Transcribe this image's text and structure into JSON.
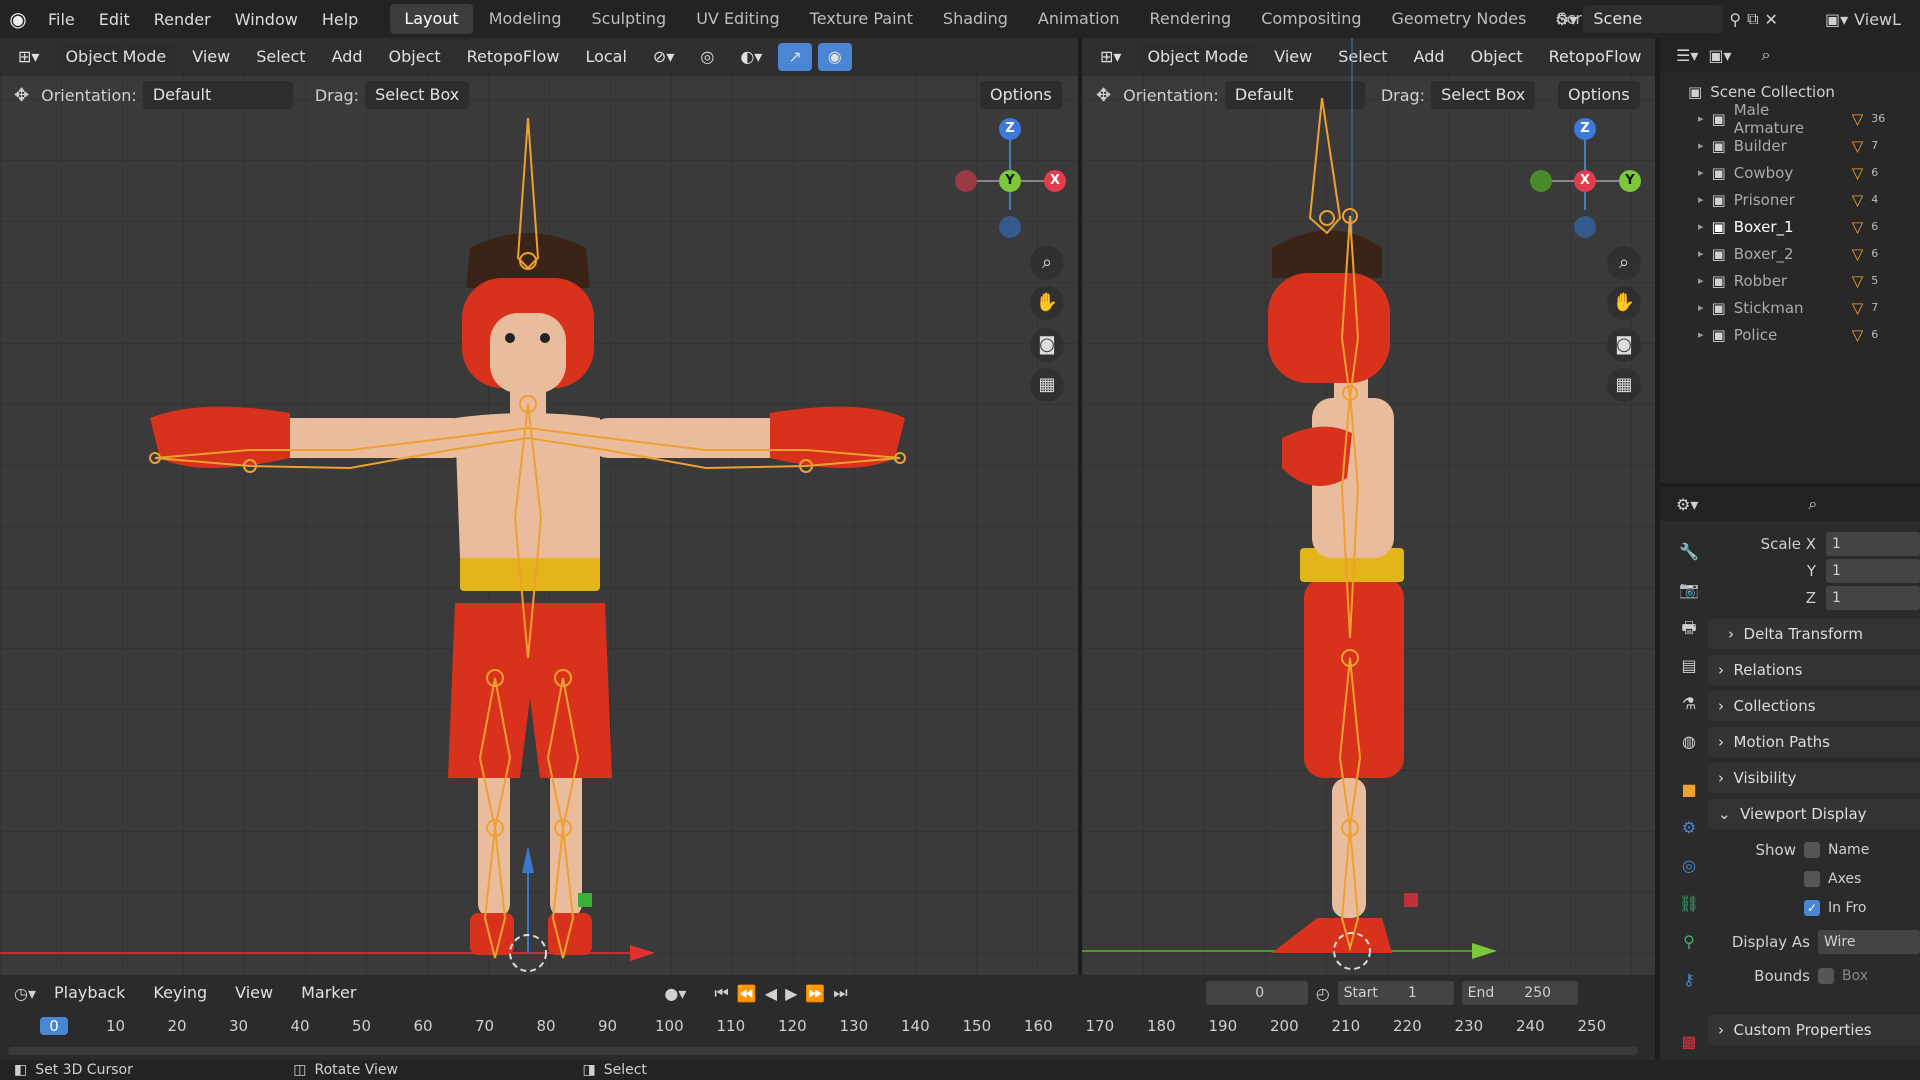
{
  "topbar": {
    "menus": [
      "File",
      "Edit",
      "Render",
      "Window",
      "Help"
    ],
    "workspaces": [
      "Layout",
      "Modeling",
      "Sculpting",
      "UV Editing",
      "Texture Paint",
      "Shading",
      "Animation",
      "Rendering",
      "Compositing",
      "Geometry Nodes",
      "Scripting"
    ],
    "active_workspace": "Layout",
    "scene_label": "Scene",
    "viewlayer_label": "ViewL"
  },
  "viewport_left": {
    "mode": "Object Mode",
    "menus": [
      "View",
      "Select",
      "Add",
      "Object"
    ],
    "addon": "RetopoFlow",
    "transform": "Local",
    "orientation_label": "Orientation:",
    "orientation_value": "Default",
    "drag_label": "Drag:",
    "drag_value": "Select Box",
    "options": "Options",
    "gizmo": {
      "top": "Z",
      "center": "Y",
      "right": "X"
    }
  },
  "viewport_right": {
    "mode": "Object Mode",
    "menus": [
      "View",
      "Select",
      "Add",
      "Object"
    ],
    "addon": "RetopoFlow",
    "orientation_label": "Orientation:",
    "orientation_value": "Default",
    "drag_label": "Drag:",
    "drag_value": "Select Box",
    "options": "Options",
    "gizmo": {
      "top": "Z",
      "center": "X",
      "right": "Y"
    }
  },
  "outliner": {
    "root": "Scene Collection",
    "items": [
      {
        "name": "Male Armature",
        "count": "36"
      },
      {
        "name": "Builder",
        "count": "7"
      },
      {
        "name": "Cowboy",
        "count": "6"
      },
      {
        "name": "Prisoner",
        "count": "4"
      },
      {
        "name": "Boxer_1",
        "count": "6"
      },
      {
        "name": "Boxer_2",
        "count": "6"
      },
      {
        "name": "Robber",
        "count": "5"
      },
      {
        "name": "Stickman",
        "count": "7"
      },
      {
        "name": "Police",
        "count": "6"
      }
    ]
  },
  "properties": {
    "scale_x_label": "Scale X",
    "scale_y_label": "Y",
    "scale_z_label": "Z",
    "scale_x": "1",
    "scale_y": "1",
    "scale_z": "1",
    "panels": [
      "Delta Transform",
      "Relations",
      "Collections",
      "Motion Paths",
      "Visibility",
      "Viewport Display"
    ],
    "show_label": "Show",
    "name_label": "Name",
    "axes_label": "Axes",
    "infront_label": "In Fro",
    "display_as_label": "Display As",
    "display_as_value": "Wire",
    "bounds_label": "Bounds",
    "bounds_value": "Box",
    "custom_props": "Custom Properties"
  },
  "timeline": {
    "menus": [
      "Playback",
      "Keying",
      "View",
      "Marker"
    ],
    "current_frame": "0",
    "start_label": "Start",
    "start": "1",
    "end_label": "End",
    "end": "250",
    "ticks": [
      "0",
      "10",
      "20",
      "30",
      "40",
      "50",
      "60",
      "70",
      "80",
      "90",
      "100",
      "110",
      "120",
      "130",
      "140",
      "150",
      "160",
      "170",
      "180",
      "190",
      "200",
      "210",
      "220",
      "230",
      "240",
      "250"
    ]
  },
  "status": {
    "items": [
      "Set 3D Cursor",
      "Rotate View",
      "Select"
    ]
  },
  "colors": {
    "accent": "#4a86d4",
    "bone": "#f0a030",
    "glove": "#d8321c",
    "belt": "#e3b51a",
    "skin": "#e8bc9c"
  }
}
